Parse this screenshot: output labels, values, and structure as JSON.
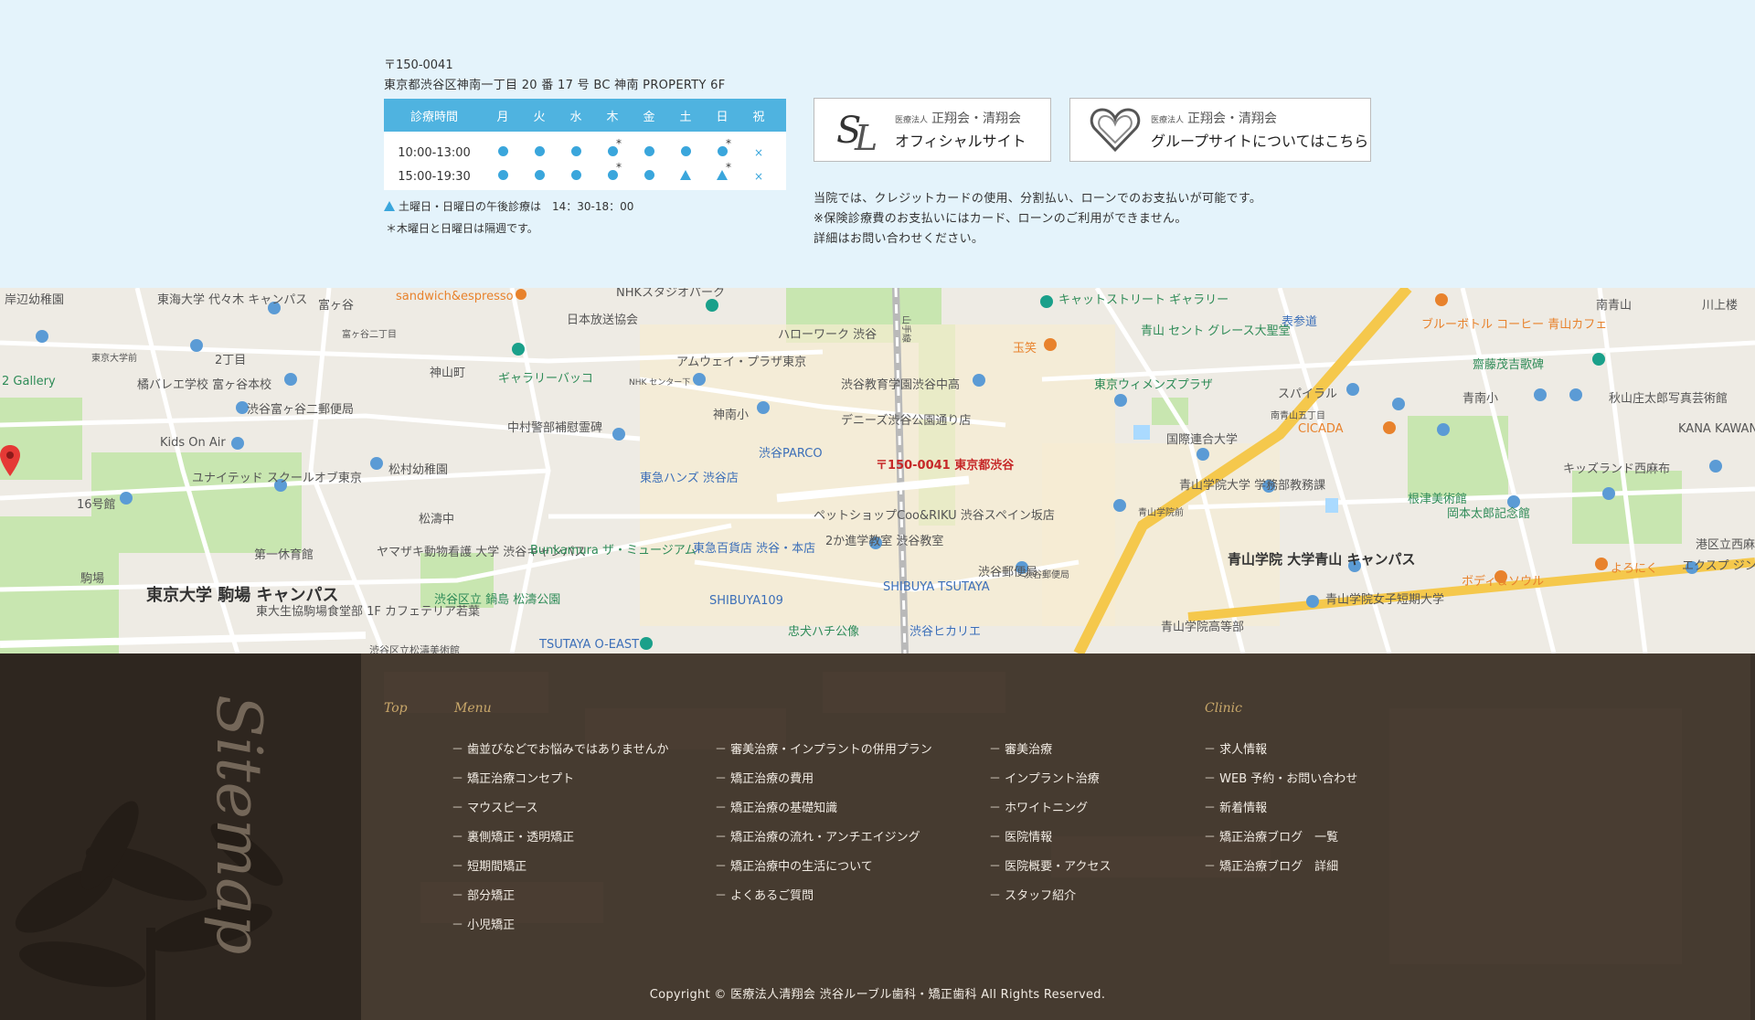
{
  "clinic": {
    "postal": "〒150-0041",
    "address": "東京都渋谷区神南一丁目 20 番 17 号  BC 神南 PROPERTY  6F"
  },
  "hours": {
    "header_label": "診療時間",
    "days": [
      "月",
      "火",
      "水",
      "木",
      "金",
      "土",
      "日",
      "祝"
    ],
    "rows": [
      {
        "time": "10:00-13:00",
        "marks": [
          "dot",
          "dot",
          "dot",
          "dot*",
          "dot",
          "dot",
          "dot*",
          "cross"
        ]
      },
      {
        "time": "15:00-19:30",
        "marks": [
          "dot",
          "dot",
          "dot",
          "dot*",
          "dot",
          "tri",
          "tri*",
          "cross"
        ]
      }
    ],
    "note_triangle": "土曜日・日曜日の午後診療は　14：30-18：00",
    "note_star": "＊木曜日と日曜日は隔週です。",
    "mark_color": "#3aa6dc",
    "header_color": "#4fb3e0"
  },
  "links": {
    "official": {
      "small": "医療法人",
      "org": "正翔会・清翔会",
      "label": "オフィシャルサイト"
    },
    "group": {
      "small": "医療法人",
      "org": "正翔会・清翔会",
      "label": "グループサイトについてはこちら"
    }
  },
  "payment": {
    "line1": "当院では、クレジットカードの使用、分割払い、ローンでのお支払いが可能です。",
    "line2": "※保険診療費のお支払いにはカード、ローンのご利用ができません。",
    "line3": "詳細はお問い合わせください。"
  },
  "map": {
    "pin_label": "〒150-0041 東京都渋谷",
    "labels": [
      "岸辺幼稚園",
      "東海大学 代々木 キャンパス",
      "富ヶ谷",
      "sandwich&espresso",
      "NHKスタジオパーク",
      "日本放送協会",
      "ハローワーク 渋谷",
      "キャットストリート ギャラリー",
      "表参道",
      "ブルーボトル コーヒー 青山カフェ",
      "南青山",
      "川上楼",
      "東京大学前",
      "富ヶ谷二丁目",
      "2丁目",
      "神山町",
      "ギャラリーバッコ",
      "アムウェイ・プラザ東京",
      "渋谷教育学園渋谷中高",
      "青山 セント グレース大聖堂",
      "玉笑",
      "齋藤茂吉歌碑",
      "2 Gallery",
      "橘バレエ学校 富ヶ谷本校",
      "渋谷富ヶ谷二郵便局",
      "NHK センター下",
      "神南小",
      "デニーズ渋谷公園通り店",
      "東京ウィメンズプラザ",
      "スパイラル",
      "青南小",
      "秋山庄太郎写真芸術館",
      "中村警部補慰霊碑",
      "南青山五丁目",
      "CICADA",
      "国際連合大学",
      "KANA KAWANISHI PHOTOGRAPHY",
      "Kids On Air",
      "渋谷PARCO",
      "東急ハンズ 渋谷店",
      "キッズランド西麻布",
      "ユナイテッド スクールオブ東京",
      "松村幼稚園",
      "16号館",
      "青山学院大学 学務部教務課",
      "根津美術館",
      "岡本太郎記念館",
      "ペットショップCoo&RIKU 渋谷スペイン坂店",
      "松濤中",
      "青山学院前",
      "第一休育館",
      "ヤマザキ動物看護 大学 渋谷キャンパス",
      "Bunkamura ザ・ミュージアム",
      "東急百貨店 渋谷・本店",
      "2か進学教室 渋谷教室",
      "渋谷郵便局",
      "青山学院 大学青山 キャンパス",
      "港区立西麻布",
      "エクスプ ジント",
      "駒場",
      "東京大学 駒場 キャンパス",
      "東大生協駒場食堂部 1F カフェテリア若葉",
      "渋谷区立 鍋島 松濤公園",
      "SHIBUYA TSUTAYA",
      "SHIBUYA109",
      "渋谷郵便局",
      "青山学院女子短期大学",
      "ボディ＆ソウル",
      "よろにく",
      "忠犬ハチ公像",
      "渋谷ヒカリエ",
      "青山学院高等部",
      "TSUTAYA O-EAST",
      "渋谷区立松濤美術館",
      "山手線"
    ]
  },
  "sitemap": {
    "title": "Sitemap",
    "top_heading": "Top",
    "menu_heading": "Menu",
    "clinic_heading": "Clinic",
    "menu_col1": [
      "歯並びなどでお悩みではありませんか",
      "矯正治療コンセプト",
      "マウスピース",
      "裏側矯正・透明矯正",
      "短期間矯正",
      "部分矯正",
      "小児矯正"
    ],
    "menu_col2": [
      "審美治療・インプラントの併用プラン",
      "矯正治療の費用",
      "矯正治療の基礎知識",
      "矯正治療の流れ・アンチエイジング",
      "矯正治療中の生活について",
      "よくあるご質問"
    ],
    "menu_col3": [
      "審美治療",
      "インプラント治療",
      "ホワイトニング",
      "医院情報",
      "医院概要・アクセス",
      "スタッフ紹介"
    ],
    "clinic_col": [
      "求人情報",
      "WEB 予約・お問い合わせ",
      "新着情報",
      "矯正治療ブログ　一覧",
      "矯正治療ブログ　詳細"
    ],
    "copyright": "Copyright © 医療法人清翔会 渋谷ルーブル歯科・矯正歯科 All Rights Reserved."
  }
}
